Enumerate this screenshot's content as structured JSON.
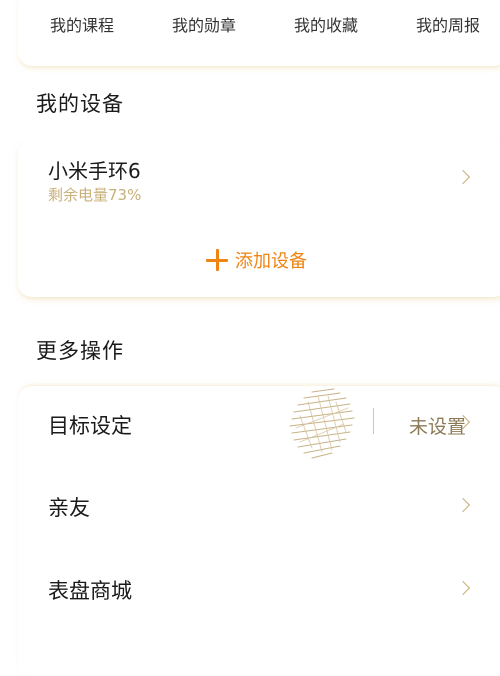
{
  "shortcuts": [
    {
      "label": "我的课程",
      "color": "#ff6a1a"
    },
    {
      "label": "我的勋章",
      "color": "#ffb000"
    },
    {
      "label": "我的收藏",
      "color": "#2f64f0"
    },
    {
      "label": "我的周报",
      "color": "#a040e8"
    }
  ],
  "devices_section": {
    "title": "我的设备",
    "device": {
      "name": "小米手环6",
      "battery": "剩余电量73%"
    },
    "add_label": "添加设备"
  },
  "more_section": {
    "title": "更多操作",
    "items": [
      {
        "label": "目标设定",
        "value": "未设置"
      },
      {
        "label": "亲友"
      },
      {
        "label": "表盘商城"
      }
    ]
  }
}
